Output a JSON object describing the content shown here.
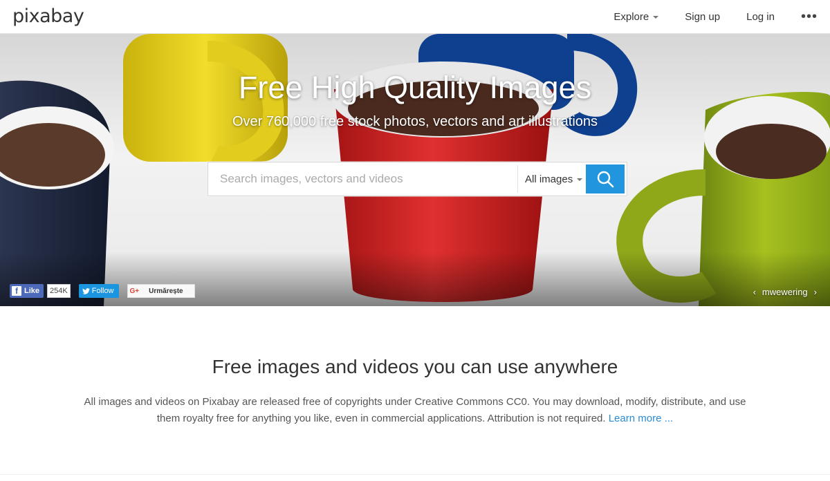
{
  "brand": {
    "logo_text": "pixabay"
  },
  "nav": {
    "explore_label": "Explore",
    "signup_label": "Sign up",
    "login_label": "Log in",
    "more_label": "•••"
  },
  "hero": {
    "title": "Free High Quality Images",
    "subtitle": "Over 760,000 free stock photos, vectors and art illustrations",
    "mug_colors": [
      "#1f2a44",
      "#e8d21e",
      "#d22a2a",
      "#0f3f8f",
      "#9bb51c"
    ]
  },
  "search": {
    "placeholder": "Search images, vectors and videos",
    "value": "",
    "type_selected": "All images",
    "button_icon": "search-icon",
    "button_color": "#2195dd"
  },
  "social": {
    "fb_like_label": "Like",
    "fb_count": "254K",
    "twitter_follow_label": "Follow",
    "gplus_label": "G+",
    "gplus_follow_label": "Urmărește"
  },
  "hero_credit": {
    "prev": "‹",
    "author": "mwewering",
    "next": "›"
  },
  "info": {
    "heading": "Free images and videos you can use anywhere",
    "text": "All images and videos on Pixabay are released free of copyrights under Creative Commons CC0. You may download, modify, distribute, and use them royalty free for anything you like, even in commercial applications. Attribution is not required. ",
    "learn_more": "Learn more ..."
  }
}
